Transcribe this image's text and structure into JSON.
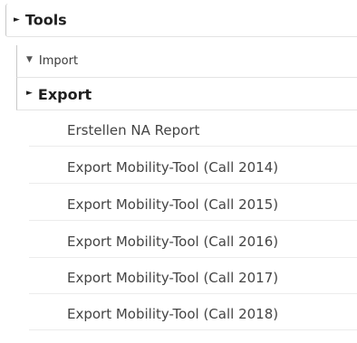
{
  "tree": {
    "tools": {
      "label": "Tools",
      "arrow_icon": "triangle-right-icon",
      "expanded": false
    },
    "import": {
      "label": "Import",
      "arrow_icon": "triangle-down-icon",
      "expanded": true
    },
    "export": {
      "label": "Export",
      "arrow_icon": "triangle-right-icon",
      "expanded": true,
      "items": [
        {
          "label": "Erstellen NA Report"
        },
        {
          "label": "Export Mobility-Tool (Call 2014)"
        },
        {
          "label": "Export Mobility-Tool (Call 2015)"
        },
        {
          "label": "Export Mobility-Tool (Call 2016)"
        },
        {
          "label": "Export Mobility-Tool (Call 2017)"
        },
        {
          "label": "Export Mobility-Tool (Call 2018)"
        }
      ]
    }
  }
}
